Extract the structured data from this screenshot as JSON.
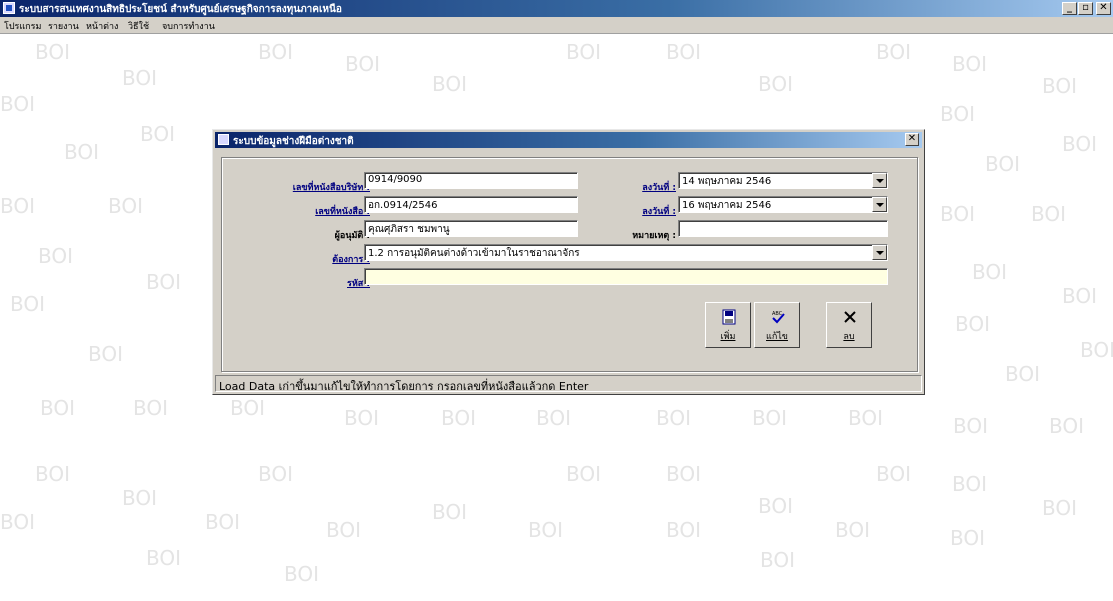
{
  "window": {
    "title": "ระบบสารสนเทศงานสิทธิประโยชน์ สำหรับศูนย์เศรษฐกิจการลงทุนภาคเหนือ",
    "controls": {
      "minimize": "_",
      "maximize": "▫",
      "close": "✕"
    }
  },
  "menu": [
    "โปรแกรม",
    "รายงาน",
    "หน้าต่าง",
    "วิธีใช้",
    "จบการทำงาน"
  ],
  "watermark_text": "BOI",
  "dialog": {
    "title": "ระบบข้อมูลช่างฝีมือต่างชาติ",
    "close": "✕",
    "fields": {
      "company_letter_no": {
        "label": "เลขที่หนังสือบริษัท :",
        "value": "0914/9090"
      },
      "company_letter_date": {
        "label": "ลงวันที่ :",
        "value": "14 พฤษภาคม  2546"
      },
      "letter_no": {
        "label": "เลขที่หนังสือ :",
        "value": "อก.0914/2546"
      },
      "letter_date": {
        "label": "ลงวันที่ :",
        "value": "16 พฤษภาคม  2546"
      },
      "approver": {
        "label": "ผู้อนุมัติ :",
        "value": "คุณศุภิสรา ชมพานู"
      },
      "remark": {
        "label": "หมายเหตุ :",
        "value": ""
      },
      "request": {
        "label": "ต้องการ :",
        "value": "1.2 การอนุมัติคนต่างด้าวเข้ามาในราชอาณาจักร"
      },
      "code": {
        "label": "รหัส :",
        "value": ""
      }
    },
    "buttons": {
      "add": "เพิ่ม",
      "edit": "แก้ไข",
      "delete": "ลบ"
    },
    "status_text": "Load Data เก่าขึ้นมาแก้ไขให้ทำการโดยการ กรอกเลขที่หนังสือแล้วกด Enter"
  }
}
